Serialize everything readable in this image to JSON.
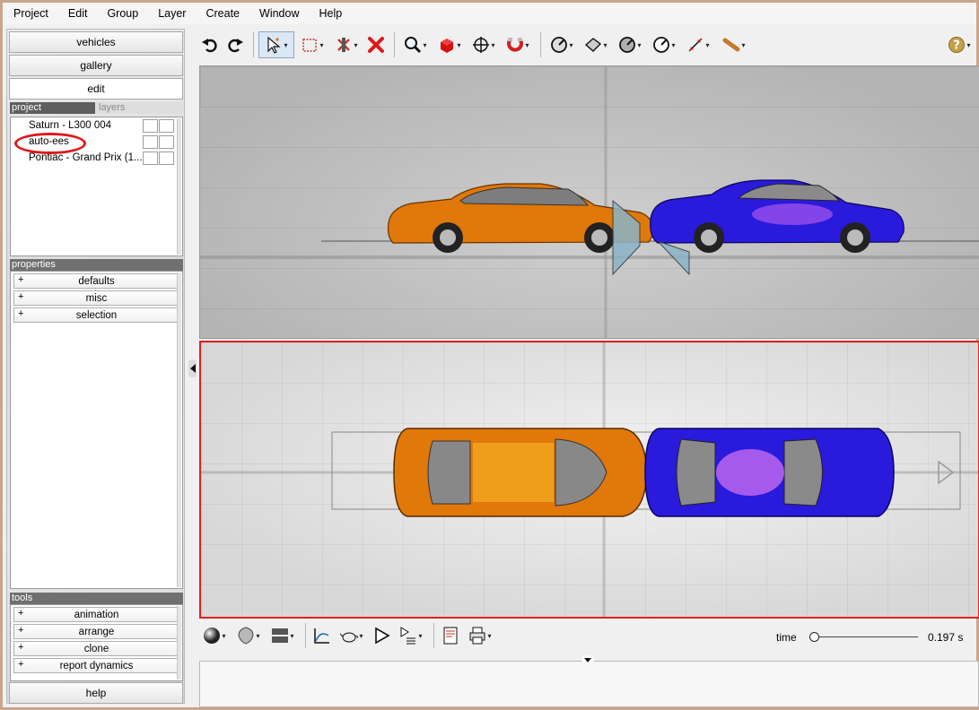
{
  "menu": [
    "Project",
    "Edit",
    "Group",
    "Layer",
    "Create",
    "Window",
    "Help"
  ],
  "nav": {
    "vehicles": "vehicles",
    "gallery": "gallery",
    "edit": "edit",
    "help": "help"
  },
  "project_panel": {
    "tab_project": "project",
    "tab_layers": "layers",
    "items": [
      "Saturn - L300 004",
      "auto-ees",
      "Pontiac - Grand Prix (1..."
    ]
  },
  "properties": {
    "header": "properties",
    "items": [
      "defaults",
      "misc",
      "selection"
    ]
  },
  "tools": {
    "header": "tools",
    "items": [
      "animation",
      "arrange",
      "clone",
      "report dynamics"
    ]
  },
  "playback": {
    "time_label": "time",
    "time_value": "0.197 s",
    "time_fraction": 0.0
  },
  "colors": {
    "accent_annotation": "#e01818",
    "selected_view_border": "#e02020",
    "car_left": "#e0780a",
    "car_right": "#2a1adb"
  },
  "toolbar_icons": [
    "undo-icon",
    "redo-icon",
    "select-icon",
    "box-select-icon",
    "tool-icon",
    "delete-icon",
    "zoom-icon",
    "cube-icon",
    "move-icon",
    "magnet-icon",
    "gauge-icon",
    "surface-icon",
    "dial-icon",
    "speed-icon",
    "measure-icon",
    "tube-icon",
    "help-icon"
  ],
  "bottom_icons": [
    "sphere-icon",
    "shield-icon",
    "panel-icon",
    "graph-icon",
    "teapot-icon",
    "play-icon",
    "play-list-icon",
    "report-icon",
    "print-icon"
  ]
}
